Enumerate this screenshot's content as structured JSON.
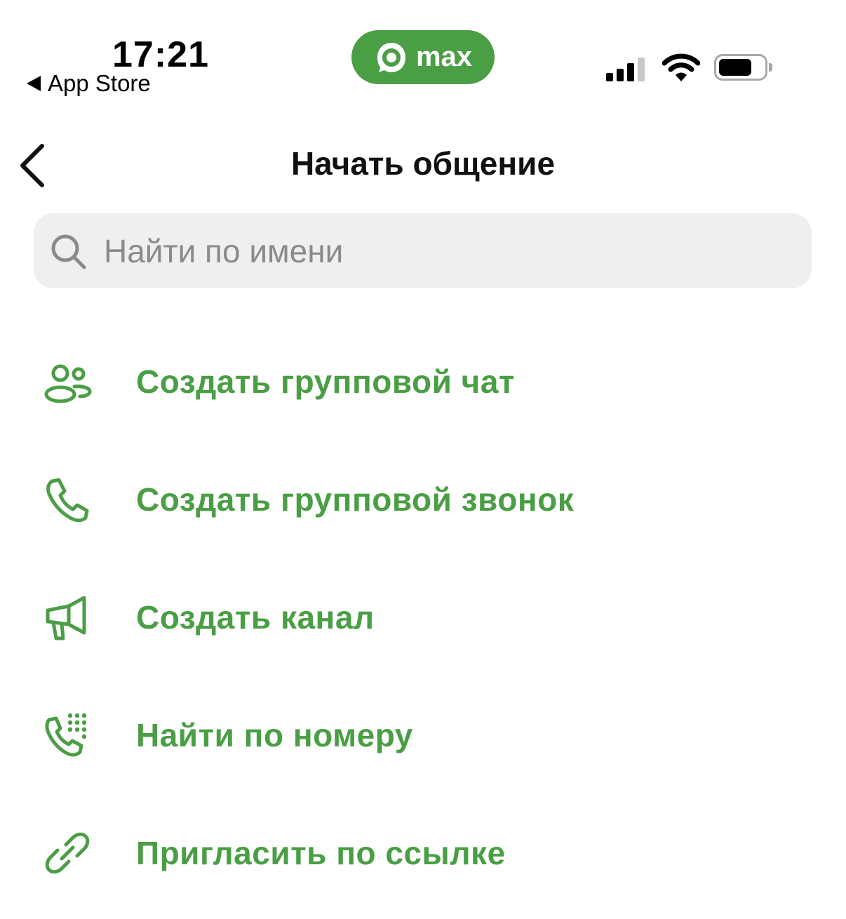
{
  "colors": {
    "accent": "#4a9e44",
    "search_bg": "#efefef",
    "placeholder": "#8a8a8e"
  },
  "status_bar": {
    "time": "17:21",
    "back_app": "App Store",
    "brand": "max",
    "icons": [
      "signal-icon",
      "wifi-icon",
      "battery-icon"
    ]
  },
  "header": {
    "title": "Начать общение",
    "back_icon": "chevron-left-icon"
  },
  "search": {
    "placeholder": "Найти по имени",
    "value": "",
    "icon": "search-icon"
  },
  "actions": [
    {
      "label": "Создать групповой чат",
      "icon": "group-chat-icon"
    },
    {
      "label": "Создать групповой звонок",
      "icon": "phone-icon"
    },
    {
      "label": "Создать канал",
      "icon": "megaphone-icon"
    },
    {
      "label": "Найти по номеру",
      "icon": "phone-keypad-icon"
    },
    {
      "label": "Пригласить по ссылке",
      "icon": "link-icon"
    }
  ]
}
